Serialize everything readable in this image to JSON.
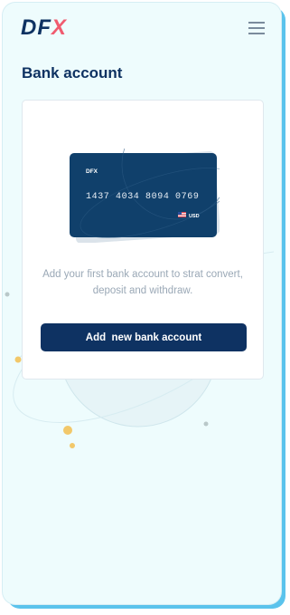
{
  "app": {
    "logo_main": "DF",
    "logo_accent": "X",
    "menu_icon": "hamburger-menu-icon"
  },
  "page": {
    "title": "Bank account"
  },
  "card_illustration": {
    "brand": "DFX",
    "number": "1437 4034 8094 0769",
    "flag_icon": "us-flag-icon",
    "currency": "USD"
  },
  "empty_state": {
    "message": "Add your first bank account to strat convert, deposit and withdraw."
  },
  "actions": {
    "add_label": "Add  new bank account"
  },
  "colors": {
    "brand_navy": "#0e3262",
    "brand_red": "#f05b6f",
    "frame_blue": "#5bc3ec",
    "background": "#eefcfd",
    "muted_text": "#9aa8b6"
  }
}
